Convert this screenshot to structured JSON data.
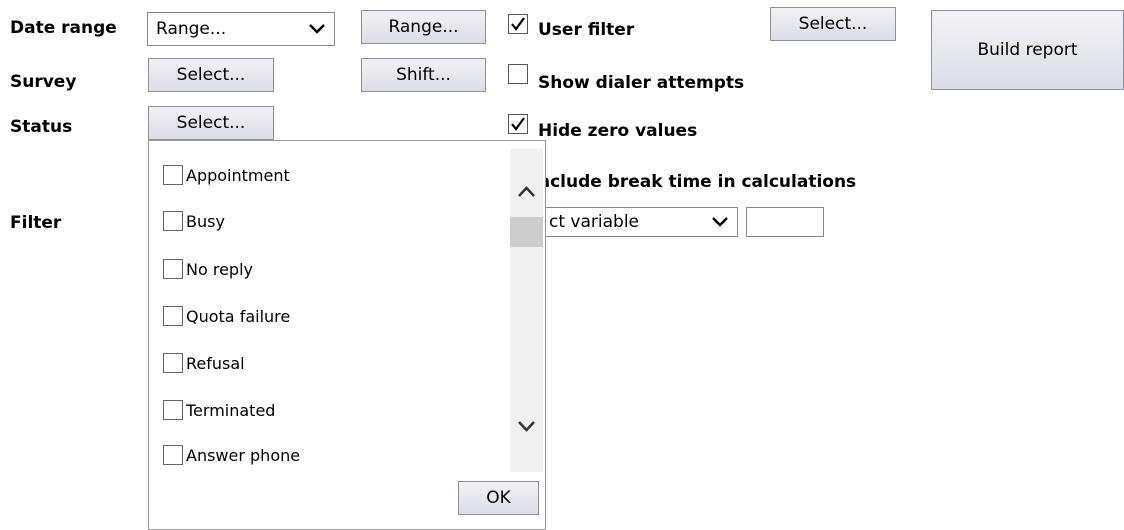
{
  "labels": {
    "date_range": "Date range",
    "survey": "Survey",
    "status": "Status",
    "filter": "Filter"
  },
  "date_range_select": {
    "value": "Range..."
  },
  "buttons": {
    "range": "Range...",
    "survey_select": "Select...",
    "shift": "Shift...",
    "status_select": "Select...",
    "user_select": "Select...",
    "build_report": "Build report",
    "ok": "OK"
  },
  "options": {
    "user_filter": {
      "label": "User filter",
      "checked": true
    },
    "show_dialer_attempts": {
      "label": "Show dialer attempts",
      "checked": false
    },
    "hide_zero_values": {
      "label": "Hide zero values",
      "checked": true
    },
    "include_break_time": {
      "label": "nclude break time in calculations"
    }
  },
  "filter_select": {
    "value": "ct variable"
  },
  "filter_value": "",
  "status_list": [
    {
      "label": "Appointment",
      "checked": false
    },
    {
      "label": "Busy",
      "checked": false
    },
    {
      "label": "No reply",
      "checked": false
    },
    {
      "label": "Quota failure",
      "checked": false
    },
    {
      "label": "Refusal",
      "checked": false
    },
    {
      "label": "Terminated",
      "checked": false
    },
    {
      "label": "Answer phone",
      "checked": false
    }
  ],
  "icons": {
    "dropdown": "chevron-down-icon",
    "check": "checkmark-icon",
    "scroll_up": "chevron-up-icon",
    "scroll_down": "chevron-down-icon"
  }
}
